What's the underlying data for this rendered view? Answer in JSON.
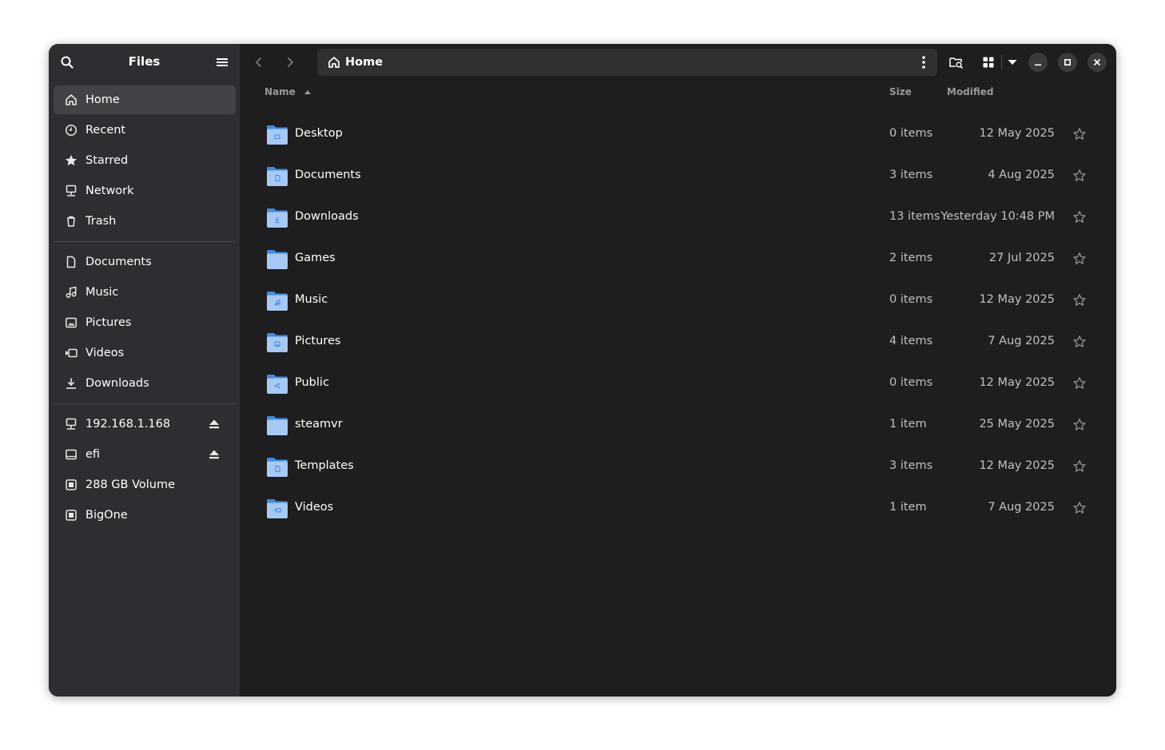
{
  "sidebar": {
    "title": "Files",
    "places": [
      {
        "label": "Home",
        "icon": "home-icon",
        "active": true
      },
      {
        "label": "Recent",
        "icon": "clock-icon"
      },
      {
        "label": "Starred",
        "icon": "star-icon"
      },
      {
        "label": "Network",
        "icon": "network-icon"
      },
      {
        "label": "Trash",
        "icon": "trash-icon"
      }
    ],
    "bookmarks": [
      {
        "label": "Documents",
        "icon": "document-icon"
      },
      {
        "label": "Music",
        "icon": "music-icon"
      },
      {
        "label": "Pictures",
        "icon": "picture-icon"
      },
      {
        "label": "Videos",
        "icon": "video-icon"
      },
      {
        "label": "Downloads",
        "icon": "download-icon"
      }
    ],
    "devices": [
      {
        "label": "192.168.1.168",
        "icon": "network-drive-icon",
        "eject": true
      },
      {
        "label": "efi",
        "icon": "drive-icon",
        "eject": true
      },
      {
        "label": "288 GB Volume",
        "icon": "disk-icon",
        "eject": false
      },
      {
        "label": "BigOne",
        "icon": "disk-icon",
        "eject": false
      }
    ]
  },
  "pathbar": {
    "current": "Home"
  },
  "columns": {
    "name": "Name",
    "size": "Size",
    "modified": "Modified"
  },
  "files": [
    {
      "name": "Desktop",
      "size": "0 items",
      "modified": "12 May 2025",
      "emblem": "desktop"
    },
    {
      "name": "Documents",
      "size": "3 items",
      "modified": "4 Aug 2025",
      "emblem": "document"
    },
    {
      "name": "Downloads",
      "size": "13 items",
      "modified": "Yesterday 10:48 PM",
      "emblem": "download"
    },
    {
      "name": "Games",
      "size": "2 items",
      "modified": "27 Jul 2025",
      "emblem": "none"
    },
    {
      "name": "Music",
      "size": "0 items",
      "modified": "12 May 2025",
      "emblem": "music"
    },
    {
      "name": "Pictures",
      "size": "4 items",
      "modified": "7 Aug 2025",
      "emblem": "picture"
    },
    {
      "name": "Public",
      "size": "0 items",
      "modified": "12 May 2025",
      "emblem": "share"
    },
    {
      "name": "steamvr",
      "size": "1 item",
      "modified": "25 May 2025",
      "emblem": "none"
    },
    {
      "name": "Templates",
      "size": "3 items",
      "modified": "12 May 2025",
      "emblem": "document"
    },
    {
      "name": "Videos",
      "size": "1 item",
      "modified": "7 Aug 2025",
      "emblem": "video"
    }
  ],
  "colors": {
    "folder": "#a6c9f5",
    "folder_tab": "#3f8ae5",
    "sidebar_bg": "#2e2e32",
    "main_bg": "#1e1e1e"
  }
}
